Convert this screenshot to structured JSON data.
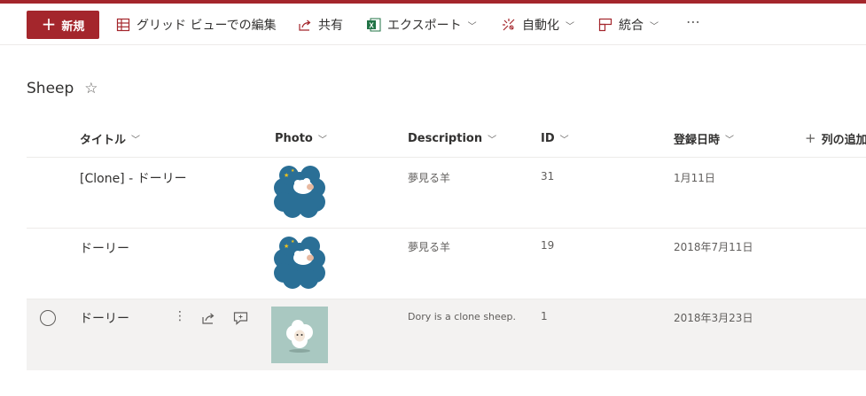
{
  "toolbar": {
    "new_label": "新規",
    "grid_view_label": "グリッド ビューでの編集",
    "share_label": "共有",
    "export_label": "エクスポート",
    "automate_label": "自動化",
    "integrate_label": "統合",
    "more_label": "⋯"
  },
  "list": {
    "title": "Sheep",
    "favorite_icon": "☆"
  },
  "columns": {
    "title": "タイトル",
    "photo": "Photo",
    "description": "Description",
    "id": "ID",
    "created": "登録日時",
    "add_column": "列の追加"
  },
  "rows": [
    {
      "title": "[Clone] - ドーリー",
      "photo": "moon-sheep",
      "description": "夢見る羊",
      "id": "31",
      "created": "1月11日"
    },
    {
      "title": "ドーリー",
      "photo": "moon-sheep",
      "description": "夢見る羊",
      "id": "19",
      "created": "2018年7月11日"
    },
    {
      "title": "ドーリー",
      "photo": "sheep-photo",
      "description": "Dory is a clone sheep.",
      "id": "1",
      "created": "2018年3月23日"
    }
  ],
  "colors": {
    "accent": "#a4262c",
    "excel_green": "#217346",
    "cloud_blue": "#2a6f96",
    "moon_yellow": "#f3c318",
    "photo_bg": "#a9c8c1"
  }
}
